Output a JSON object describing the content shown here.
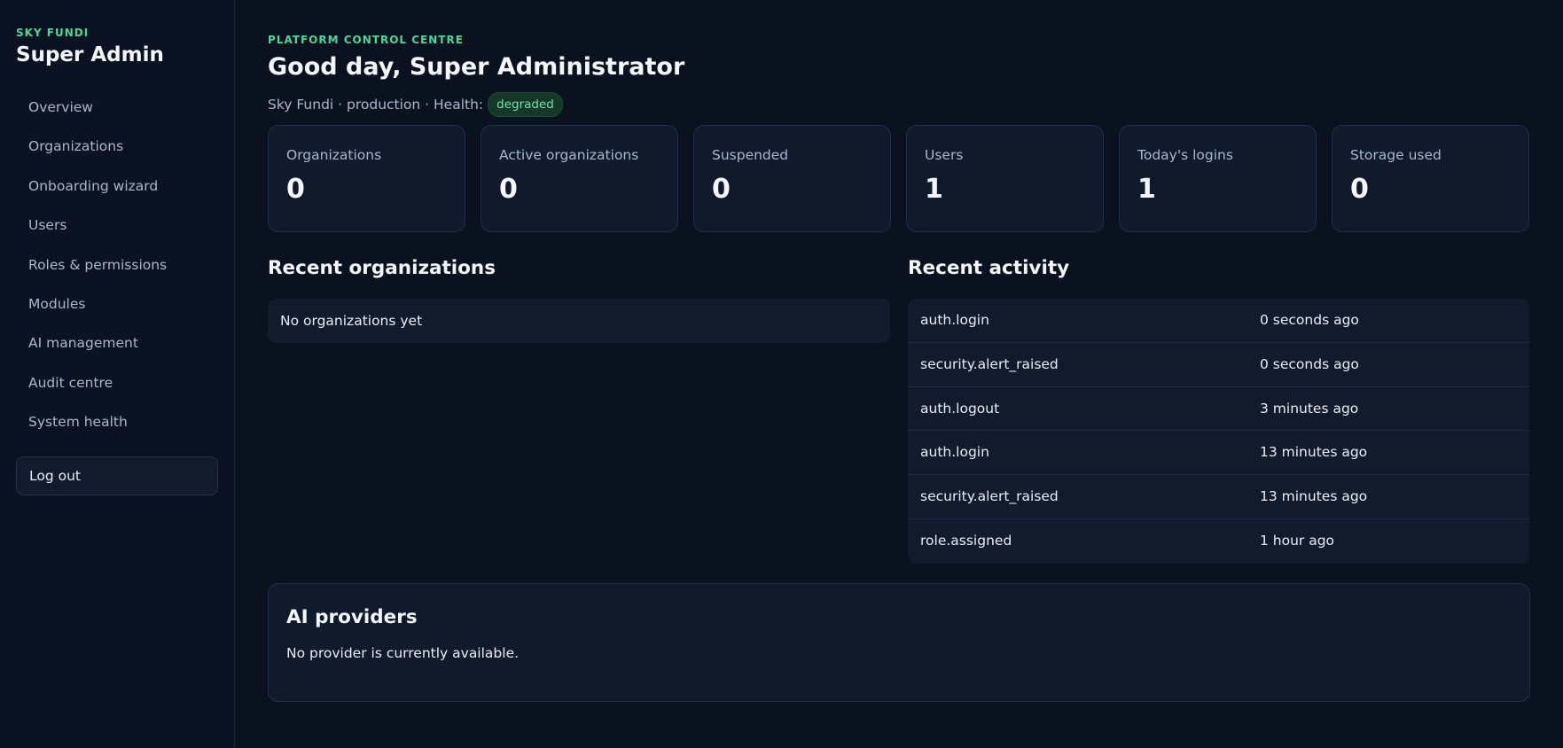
{
  "sidebar": {
    "eyebrow": "SKY FUNDI",
    "title": "Super Admin",
    "items": [
      {
        "label": "Overview"
      },
      {
        "label": "Organizations"
      },
      {
        "label": "Onboarding wizard"
      },
      {
        "label": "Users"
      },
      {
        "label": "Roles & permissions"
      },
      {
        "label": "Modules"
      },
      {
        "label": "AI management"
      },
      {
        "label": "Audit centre"
      },
      {
        "label": "System health"
      }
    ],
    "logout_label": "Log out"
  },
  "header": {
    "eyebrow": "PLATFORM CONTROL CENTRE",
    "title": "Good day, Super Administrator",
    "subline": "Sky Fundi · production · Health:",
    "health_badge": "degraded"
  },
  "stats": [
    {
      "label": "Organizations",
      "value": "0"
    },
    {
      "label": "Active organizations",
      "value": "0"
    },
    {
      "label": "Suspended",
      "value": "0"
    },
    {
      "label": "Users",
      "value": "1"
    },
    {
      "label": "Today's logins",
      "value": "1"
    },
    {
      "label": "Storage used",
      "value": "0"
    }
  ],
  "recent_organizations": {
    "title": "Recent organizations",
    "empty_text": "No organizations yet"
  },
  "recent_activity": {
    "title": "Recent activity",
    "rows": [
      {
        "event": "auth.login",
        "time": "0 seconds ago"
      },
      {
        "event": "security.alert_raised",
        "time": "0 seconds ago"
      },
      {
        "event": "auth.logout",
        "time": "3 minutes ago"
      },
      {
        "event": "auth.login",
        "time": "13 minutes ago"
      },
      {
        "event": "security.alert_raised",
        "time": "13 minutes ago"
      },
      {
        "event": "role.assigned",
        "time": "1 hour ago"
      }
    ]
  },
  "ai_providers": {
    "title": "AI providers",
    "text": "No provider is currently available."
  },
  "colors": {
    "accent": "#4ed69a",
    "background": "#0a1220",
    "card": "#101a2b",
    "badge_bg": "#143728"
  }
}
